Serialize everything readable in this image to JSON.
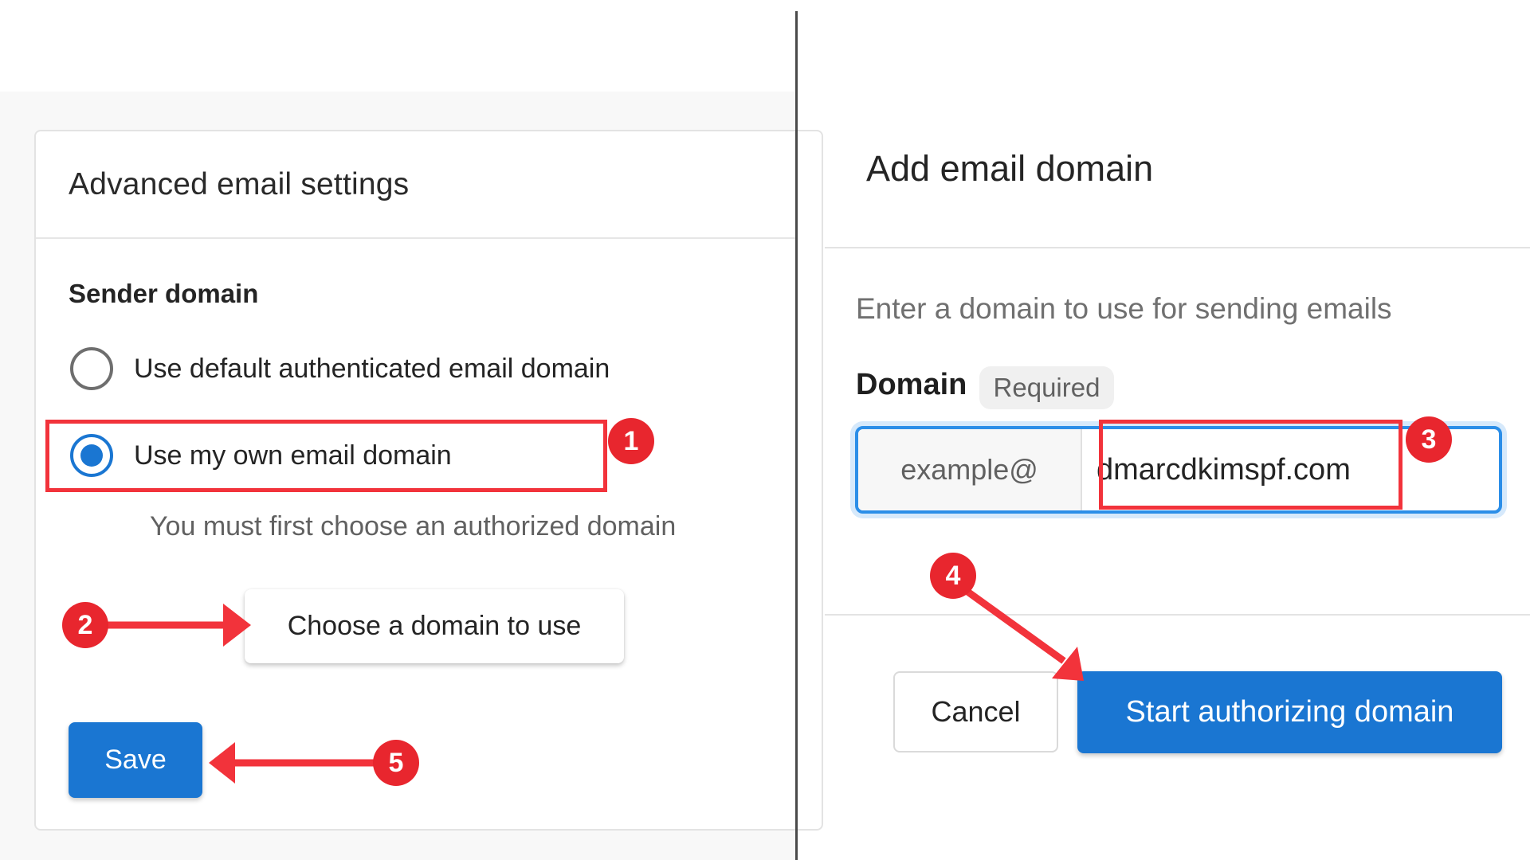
{
  "left_panel": {
    "card_title": "Advanced email settings",
    "section_label": "Sender domain",
    "options": [
      {
        "label": "Use default authenticated email domain",
        "checked": false
      },
      {
        "label": "Use my own email domain",
        "checked": true
      }
    ],
    "helper_text": "You must first choose an authorized domain",
    "choose_button_label": "Choose a domain to use",
    "save_button_label": "Save"
  },
  "right_panel": {
    "title": "Add email domain",
    "subtitle": "Enter a domain to use for sending emails",
    "field_label": "Domain",
    "required_chip": "Required",
    "input_prefix": "example@",
    "input_value": "dmarcdkimspf.com",
    "cancel_label": "Cancel",
    "start_label": "Start authorizing domain"
  },
  "annotations": {
    "color": "#e8262e",
    "steps": [
      "1",
      "2",
      "3",
      "4",
      "5"
    ]
  },
  "colors": {
    "primary": "#1a76d2",
    "focus_border": "#2b8ee8"
  }
}
